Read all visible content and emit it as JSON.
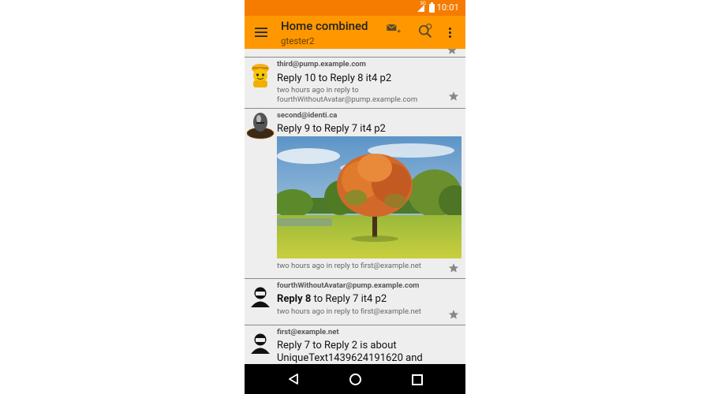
{
  "status_bar": {
    "time": "10:01",
    "network": "3G"
  },
  "toolbar": {
    "title": "Home combined",
    "subtitle": "gtester2"
  },
  "colors": {
    "toolbar": "#ff9800",
    "status_bar": "#f57c00",
    "list_bg": "#eeeeee"
  },
  "icons": [
    "menu-icon",
    "compose-mail-icon",
    "search-icon",
    "overflow-menu-icon",
    "star-icon",
    "back-icon",
    "home-icon",
    "recent-apps-icon"
  ],
  "timeline": [
    {
      "author": "third@pump.example.com",
      "body": "Reply 10 to Reply 8 it4 p2",
      "meta_line1": "two hours ago in reply to",
      "meta_line2": "fourthWithoutAvatar@pump.example.com"
    },
    {
      "author": "second@identi.ca",
      "body": "Reply 9 to Reply 7 it4 p2",
      "meta_line1": "two hours ago in reply to first@example.net"
    },
    {
      "author": "fourthWithoutAvatar@pump.example.com",
      "body_bold": "Reply 8",
      "body_rest": " to Reply 7 it4 p2",
      "meta_line1": "two hours ago in reply to first@example.net"
    },
    {
      "author": "first@example.net",
      "body_line1": "Reply 7 to Reply 2 is about",
      "body_line2": "UniqueText1439624191620 and"
    }
  ]
}
